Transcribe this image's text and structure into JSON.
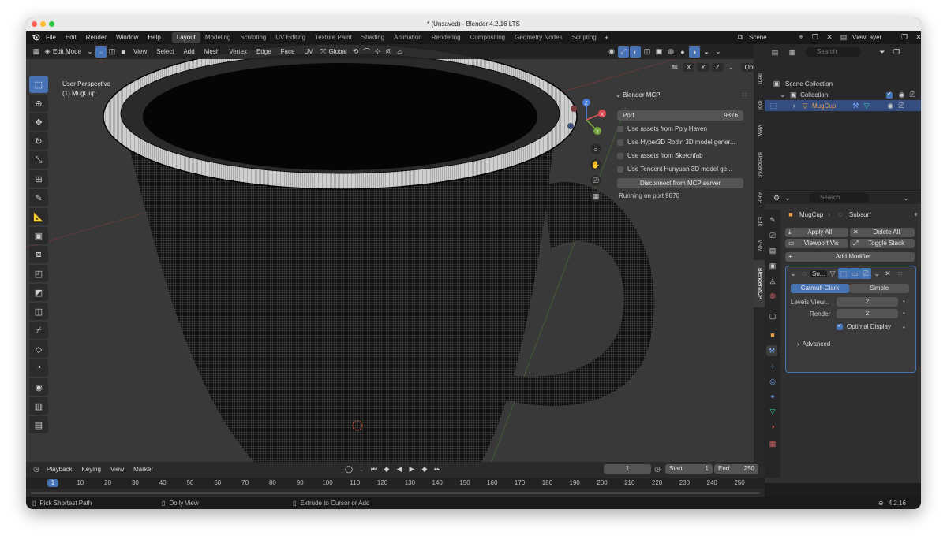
{
  "title": "* (Unsaved) - Blender 4.2.16 LTS",
  "menu": [
    "File",
    "Edit",
    "Render",
    "Window",
    "Help"
  ],
  "workspaces": [
    "Layout",
    "Modeling",
    "Sculpting",
    "UV Editing",
    "Texture Paint",
    "Shading",
    "Animation",
    "Rendering",
    "Compositing",
    "Geometry Nodes",
    "Scripting"
  ],
  "scene": "Scene",
  "view_layer": "ViewLayer",
  "viewport": {
    "mode": "Edit Mode",
    "menus": [
      "View",
      "Select",
      "Add",
      "Mesh",
      "Vertex",
      "Edge",
      "Face",
      "UV"
    ],
    "orientation": "Global",
    "options": "Options",
    "axes": [
      "X",
      "Y",
      "Z"
    ],
    "overlay_title": "User Perspective",
    "overlay_object": "(1) MugCup"
  },
  "mcp_panel": {
    "title": "Blender MCP",
    "port_label": "Port",
    "port_value": "9876",
    "options": [
      "Use assets from Poly Haven",
      "Use Hyper3D Rodin 3D model gener...",
      "Use assets from Sketchfab",
      "Use Tencent Hunyuan 3D model ge..."
    ],
    "disconnect": "Disconnect from MCP server",
    "status": "Running on port 9876"
  },
  "side_tabs": [
    "Item",
    "Tool",
    "View",
    "BlenderKit",
    "ARP",
    "Edit",
    "VRM",
    "BlenderMCP"
  ],
  "outliner": {
    "search_placeholder": "Search",
    "scene_collection": "Scene Collection",
    "collection": "Collection",
    "object": "MugCup"
  },
  "properties": {
    "search_placeholder": "Search",
    "object": "MugCup",
    "modifier": "Subsurf",
    "apply_all": "Apply All",
    "delete_all": "Delete All",
    "viewport_vis": "Viewport Vis",
    "toggle_stack": "Toggle Stack",
    "add_modifier": "Add Modifier",
    "modifier_name": "Su...",
    "catmull_clark": "Catmull-Clark",
    "simple": "Simple",
    "levels_label": "Levels View...",
    "levels_value": "2",
    "render_label": "Render",
    "render_value": "2",
    "optimal_display": "Optimal Display",
    "advanced": "Advanced"
  },
  "timeline": {
    "menus": [
      "Playback",
      "Keying",
      "View",
      "Marker"
    ],
    "current_frame": "1",
    "start_label": "Start",
    "start_value": "1",
    "end_label": "End",
    "end_value": "250",
    "ticks": [
      "1",
      "10",
      "20",
      "30",
      "40",
      "50",
      "60",
      "70",
      "80",
      "90",
      "100",
      "110",
      "120",
      "130",
      "140",
      "150",
      "160",
      "170",
      "180",
      "190",
      "200",
      "210",
      "220",
      "230",
      "240",
      "250"
    ]
  },
  "status": {
    "left": "Pick Shortest Path",
    "middle": "Dolly View",
    "right": "Extrude to Cursor or Add",
    "version": "4.2.16"
  },
  "colors": {
    "accent": "#4772b3",
    "object_orange": "#e9a046",
    "viewport_bg": "#393939"
  }
}
